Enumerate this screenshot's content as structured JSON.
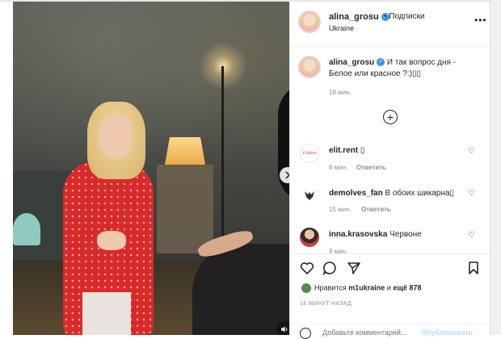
{
  "post": {
    "author": "alina_grosu",
    "location": "Ukraine",
    "follow_label": "• Подписки",
    "more_label": "•••"
  },
  "caption": {
    "author": "alina_grosu",
    "line1": "И так вопрос дня -",
    "line2": "Белое или красное ?:)▯▯",
    "time": "18 мин."
  },
  "comments": [
    {
      "user": "elit.rent",
      "text": "▯",
      "time": "6 мин.",
      "reply": "Ответить"
    },
    {
      "user": "demolves_fan",
      "text": "В обоих шикарна▯",
      "time": "15 мин.",
      "reply": "Ответить"
    },
    {
      "user": "inna.krasovska",
      "text": "Червоне",
      "time": "8 мин.",
      "reply": "Ответить"
    }
  ],
  "avatars": {
    "elit_rent_logo": "ElitRent"
  },
  "likes": {
    "prefix": "Нравится",
    "user": "m1ukraine",
    "mid": "и",
    "count_text": "ещё 878"
  },
  "timestamp": "18 МИНУТ НАЗАД",
  "composer": {
    "placeholder": "Добавьте комментарий...",
    "publish": "Опубликовать"
  },
  "colors": {
    "verified": "#3897f0",
    "publish_disabled": "#b2dffc",
    "muted": "#8e8e8e"
  }
}
